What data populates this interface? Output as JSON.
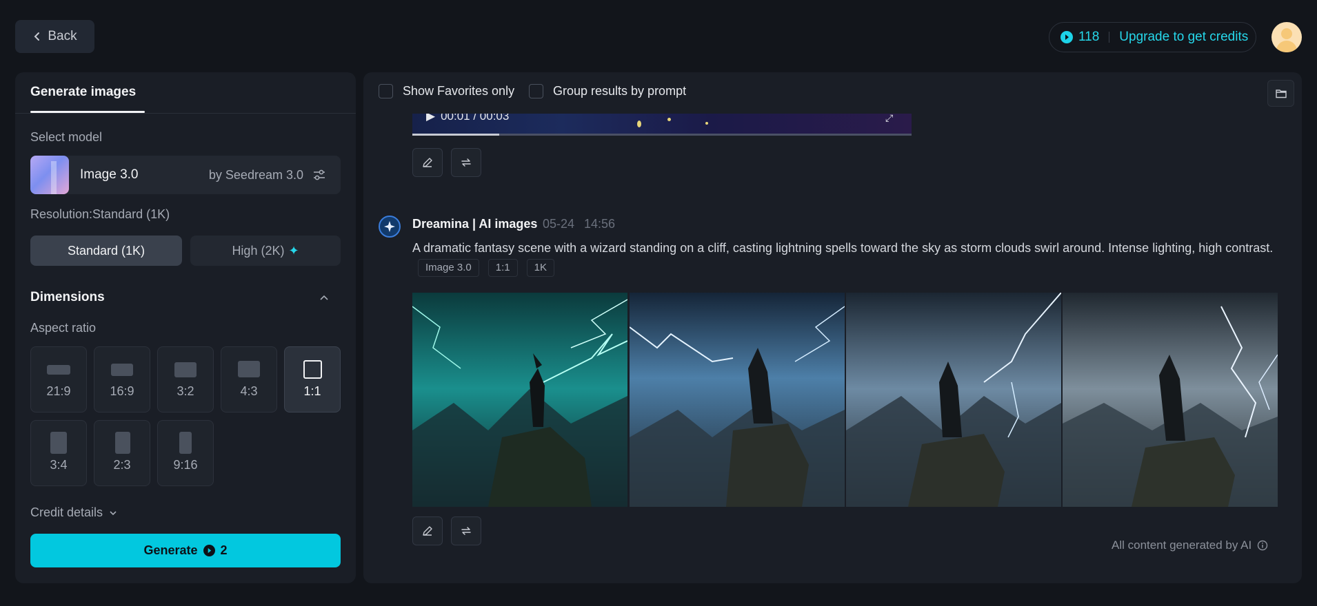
{
  "header": {
    "back_label": "Back",
    "credits_count": "118",
    "upgrade_label": "Upgrade to get credits"
  },
  "left": {
    "tab_label": "Generate images",
    "select_model_label": "Select model",
    "model_name": "Image 3.0",
    "model_by": "by Seedream 3.0",
    "resolution_label": "Resolution:Standard (1K)",
    "res_standard": "Standard (1K)",
    "res_high": "High (2K)",
    "dimensions_title": "Dimensions",
    "aspect_ratio_label": "Aspect ratio",
    "ratios": [
      "21:9",
      "16:9",
      "3:2",
      "4:3",
      "1:1",
      "3:4",
      "2:3",
      "9:16"
    ],
    "selected_ratio": "1:1",
    "credit_details": "Credit details",
    "generate_label": "Generate",
    "generate_cost": "2"
  },
  "right": {
    "show_favorites": "Show Favorites only",
    "group_results": "Group results by prompt",
    "video_time": "00:01 / 00:03",
    "bot_name": "Dreamina | AI images",
    "bot_date": "05-24",
    "bot_time": "14:56",
    "prompt": "A dramatic fantasy scene with a wizard standing on a cliff, casting lightning spells toward the sky as storm clouds swirl around. Intense lighting, high contrast.",
    "tags": [
      "Image 3.0",
      "1:1",
      "1K"
    ],
    "footer_note": "All content generated by AI"
  },
  "colors": {
    "accent": "#02c8df",
    "background": "#12151b",
    "panel": "#1a1e26"
  }
}
